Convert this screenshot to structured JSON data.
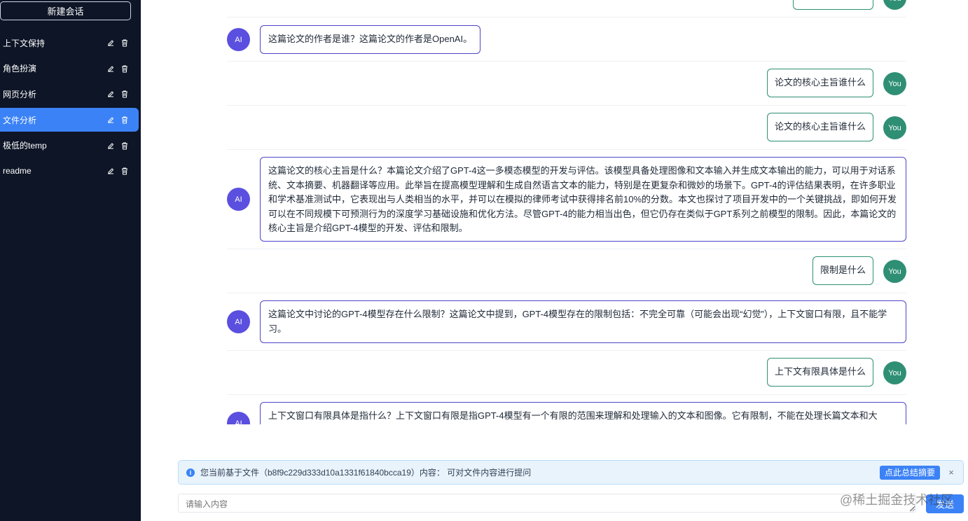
{
  "sidebar": {
    "new_chat_label": "新建会话",
    "items": [
      {
        "label": "上下文保持"
      },
      {
        "label": "角色扮演"
      },
      {
        "label": "网页分析"
      },
      {
        "label": "文件分析"
      },
      {
        "label": "极低的temp"
      },
      {
        "label": "readme"
      }
    ]
  },
  "chat": {
    "ai_avatar": "AI",
    "you_avatar": "You",
    "messages": [
      "这篇论文的作者是谁？这篇论文的作者是OpenAI。",
      "论文的核心主旨谁什么",
      "论文的核心主旨谁什么",
      "这篇论文的核心主旨是什么？本篇论文介绍了GPT-4这一多模态模型的开发与评估。该模型具备处理图像和文本输入并生成文本输出的能力，可以用于对话系统、文本摘要、机器翻译等应用。此举旨在提高模型理解和生成自然语言文本的能力，特别是在更复杂和微妙的场景下。GPT-4的评估结果表明，在许多职业和学术基准测试中，它表现出与人类相当的水平，并可以在模拟的律师考试中获得排名前10%的分数。本文也探讨了项目开发中的一个关键挑战，即如何开发可以在不同规模下可预测行为的深度学习基础设施和优化方法。尽管GPT-4的能力相当出色，但它仍存在类似于GPT系列之前模型的限制。因此，本篇论文的核心主旨是介绍GPT-4模型的开发、评估和限制。",
      "限制是什么",
      "这篇论文中讨论的GPT-4模型存在什么限制？这篇论文中提到，GPT-4模型存在的限制包括：不完全可靠（可能会出现“幻觉”），上下文窗口有限，且不能学习。",
      "上下文有限具体是什么",
      "上下文窗口有限具体是指什么？上下文窗口有限是指GPT-4模型有一个有限的范围来理解和处理输入的文本和图像。它有限制，不能在处理长篇文本和大"
    ]
  },
  "info_bar": {
    "text": "您当前基于文件（b8f9c229d333d10a1331f61840bcca19）内容： 可对文件内容进行提问",
    "summary_button": "点此总结摘要",
    "close_label": "×"
  },
  "input": {
    "placeholder": "请输入内容",
    "send_label": "发送"
  },
  "watermark": "@稀土掘金技术社区",
  "colors": {
    "sidebar_bg": "#0d1526",
    "active_item": "#3b82f6",
    "ai_avatar": "#5b4fe0",
    "you_avatar": "#2f8f74"
  }
}
